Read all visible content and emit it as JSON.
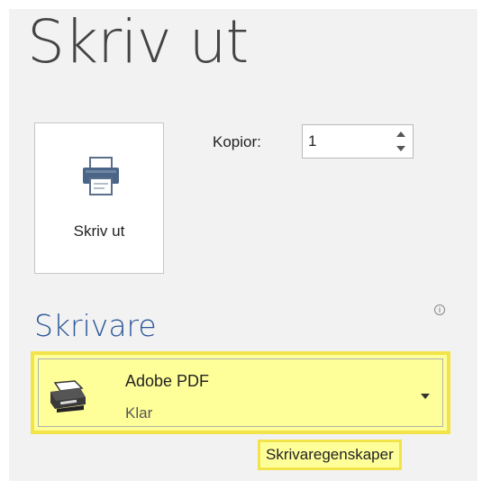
{
  "page": {
    "title": "Skriv ut"
  },
  "print_button": {
    "label": "Skriv ut",
    "icon": "printer-icon"
  },
  "copies": {
    "label": "Kopior:",
    "value": "1"
  },
  "printer_section": {
    "title": "Skrivare",
    "selected_printer": {
      "name": "Adobe PDF",
      "status": "Klar",
      "icon": "pdf-printer-icon"
    },
    "properties_link": "Skrivaregenskaper"
  },
  "colors": {
    "accent": "#2b579a",
    "highlight": "#ffff9a",
    "highlight_border": "#f2e34a"
  }
}
